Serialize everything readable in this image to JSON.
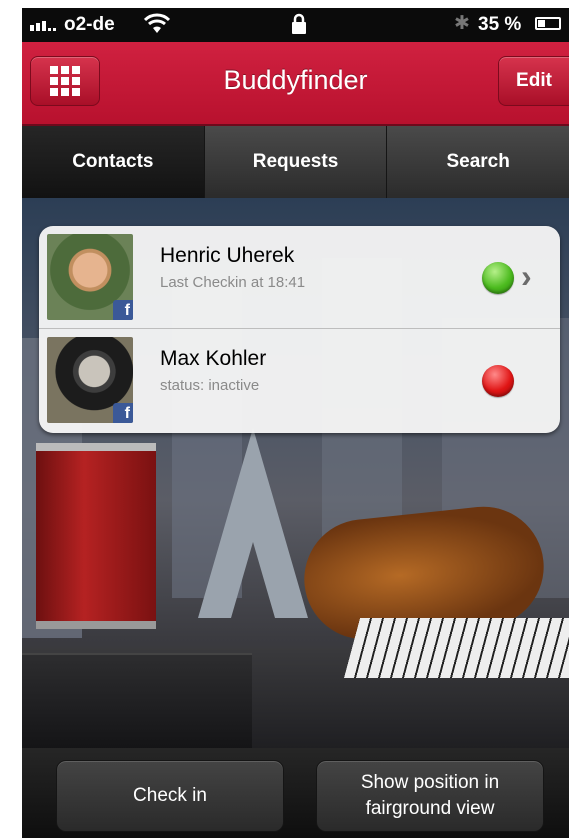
{
  "status_bar": {
    "carrier": "o2-de",
    "battery": "35 %",
    "icons": [
      "signal-icon",
      "wifi-icon",
      "lock-icon",
      "bluetooth-icon",
      "battery-icon"
    ]
  },
  "nav": {
    "title": "Buddyfinder",
    "edit_label": "Edit",
    "menu_icon": "grid-icon"
  },
  "tabs": [
    {
      "label": "Contacts",
      "active": true
    },
    {
      "label": "Requests",
      "active": false
    },
    {
      "label": "Search",
      "active": false
    }
  ],
  "contacts": [
    {
      "name": "Henric Uherek",
      "subtitle": "Last Checkin at 18:41",
      "status": "online",
      "status_color": "#4cbb1f",
      "has_chevron": true
    },
    {
      "name": "Max Kohler",
      "subtitle": "status: inactive",
      "status": "inactive",
      "status_color": "#e01515",
      "has_chevron": false
    }
  ],
  "bottom": {
    "check_in_label": "Check in",
    "show_position_label": "Show position in\nfairground view"
  },
  "colors": {
    "accent": "#c8163a",
    "facebook": "#3b5998"
  }
}
